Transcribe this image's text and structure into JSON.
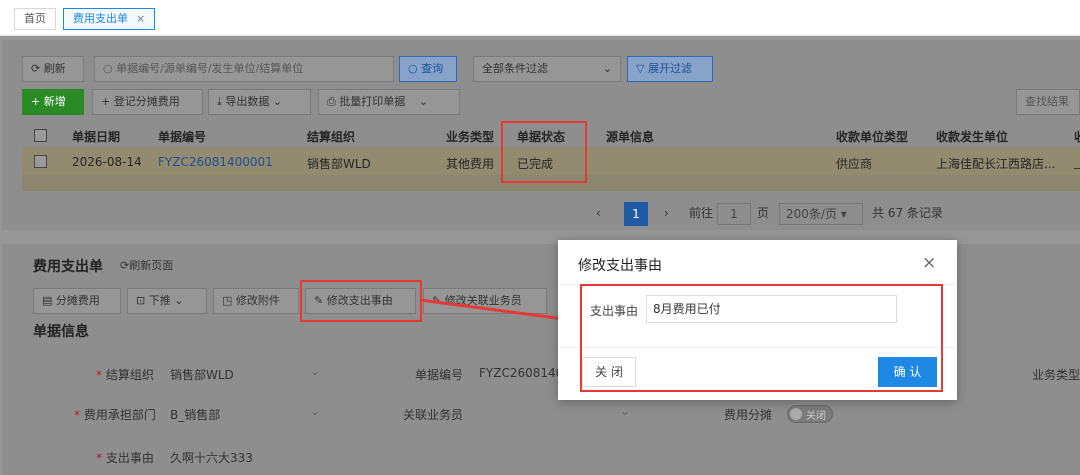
{
  "tabs": [
    {
      "label": "首页"
    },
    {
      "label": "费用支出单",
      "close": "×"
    }
  ],
  "toolbar": {
    "refresh": "刷新",
    "search_placeholder": "单据编号/源单编号/发生单位/结算单位",
    "query": "查询",
    "filter": "全部条件过滤",
    "expand_filter": "展开过滤",
    "add": "+ 新增",
    "register_share": "+ 登记分摊费用",
    "export": "导出数据",
    "batch_print": "批量打印单据",
    "search_results": "查找结果"
  },
  "table": {
    "headers": [
      "单据日期",
      "单据编号",
      "结算组织",
      "业务类型",
      "单据状态",
      "源单信息",
      "收款单位类型",
      "收款发生单位"
    ],
    "rows": [
      [
        "2026-08-14",
        "FYZC26081400001",
        "销售部WLD",
        "其他费用",
        "已完成",
        "",
        "供应商",
        "上海佳配长江西路店..."
      ]
    ],
    "cut_header": "收",
    "cut_cell": "_"
  },
  "pagination": {
    "page": "1",
    "goto": "前往",
    "goto_value": "1",
    "page_unit": "页",
    "page_size": "200条/页",
    "total": "共 67 条记录"
  },
  "detail": {
    "title": "费用支出单",
    "refresh_page": "刷新页面",
    "buttons": [
      "分摊费用",
      "下推",
      "修改附件",
      "修改支出事由",
      "修改关联业务员"
    ],
    "section": "单据信息",
    "fields": {
      "org_label": "结算组织",
      "org_value": "销售部WLD",
      "no_label": "单据编号",
      "no_value": "FYZC26081400",
      "biz_label": "业务类型",
      "dept_label": "费用承担部门",
      "dept_value": "B_销售部",
      "salesman_label": "关联业务员",
      "share_label": "费用分摊",
      "share_value": "关闭",
      "reason_label": "支出事由",
      "reason_value": "久啊十六大333"
    }
  },
  "dialog": {
    "title": "修改支出事由",
    "close_icon": "×",
    "field_label": "支出事由",
    "field_value": "8月费用已付",
    "close_btn": "关 闭",
    "confirm_btn": "确 认"
  },
  "colors": {
    "accent": "#1e88e5",
    "highlight": "#e53935",
    "success": "#2a8a26"
  }
}
